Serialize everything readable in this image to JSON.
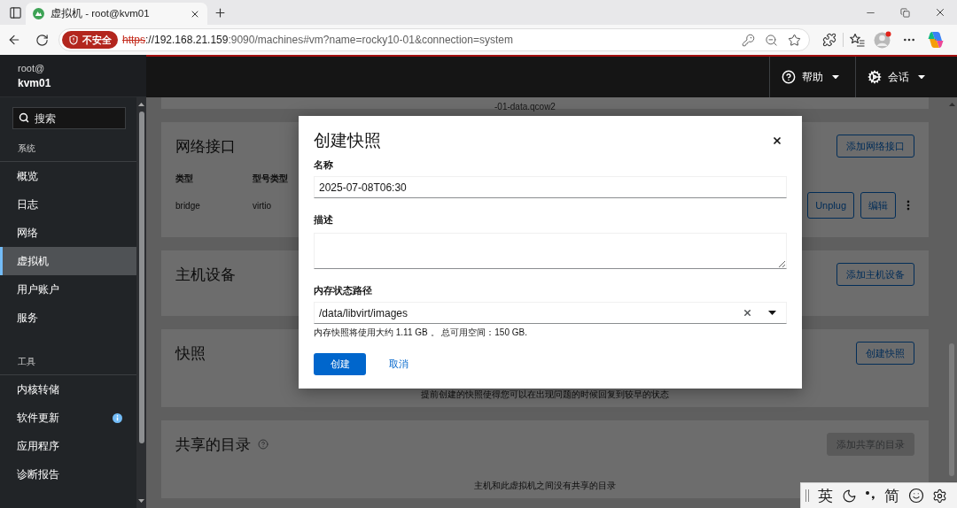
{
  "browser": {
    "tab": {
      "title": "虚拟机 - root@kvm01",
      "selected": true
    },
    "security_label": "不安全",
    "url": {
      "scheme": "https",
      "host": "://192.168.21.159",
      "path": ":9090/machines#vm?name=rocky10-01&connection=system"
    }
  },
  "sidebar": {
    "user": "root@",
    "host": "kvm01",
    "search": {
      "placeholder": "搜索"
    },
    "sections": [
      {
        "title": "系统",
        "items": [
          {
            "label": "概览",
            "selected": false,
            "notification": false
          },
          {
            "label": "日志",
            "selected": false,
            "notification": false
          },
          {
            "label": "网络",
            "selected": false,
            "notification": false
          },
          {
            "label": "虚拟机",
            "selected": true,
            "notification": false
          },
          {
            "label": "用户账户",
            "selected": false,
            "notification": false
          },
          {
            "label": "服务",
            "selected": false,
            "notification": false
          }
        ]
      },
      {
        "title": "工具",
        "items": [
          {
            "label": "内核转储",
            "selected": false,
            "notification": false
          },
          {
            "label": "软件更新",
            "selected": false,
            "notification": true
          },
          {
            "label": "应用程序",
            "selected": false,
            "notification": false
          },
          {
            "label": "诊断报告",
            "selected": false,
            "notification": false
          }
        ]
      }
    ]
  },
  "header": {
    "menus": [
      {
        "kind": "help",
        "label": "帮助"
      },
      {
        "kind": "session",
        "label": "会话"
      }
    ]
  },
  "content": {
    "disk_fragment": "-01-data.qcow2",
    "cards": [
      {
        "title": "网络接口",
        "help": false,
        "button": {
          "label": "添加网络接口",
          "disabled": false
        },
        "table": {
          "columns": [
            "类型",
            "型号类型"
          ],
          "rows": [
            {
              "cells": [
                "bridge",
                "virtio"
              ],
              "actions": [
                "Unplug",
                "编辑"
              ]
            }
          ]
        }
      },
      {
        "title": "主机设备",
        "help": false,
        "button": {
          "label": "添加主机设备",
          "disabled": false
        }
      },
      {
        "title": "快照",
        "help": false,
        "button": {
          "label": "创建快照",
          "disabled": false
        },
        "empty_text": "提前创建的快照使得您可以在出现问题的时候回复到较早的状态"
      },
      {
        "title": "共享的目录",
        "help": true,
        "button": {
          "label": "添加共享的目录",
          "disabled": true
        },
        "empty_text": "主机和此虚拟机之间没有共享的目录"
      }
    ]
  },
  "dialog": {
    "title": "创建快照",
    "fields": [
      {
        "kind": "text",
        "label": "名称",
        "value": "2025-07-08T06:30"
      },
      {
        "kind": "textarea",
        "label": "描述"
      },
      {
        "kind": "select",
        "label": "内存状态路径",
        "value": "/data/libvirt/images",
        "helper": "内存快照将使用大约 1.11 GB 。 总可用空间：150 GB."
      }
    ],
    "buttons": [
      {
        "kind": "primary",
        "label": "创建"
      },
      {
        "kind": "link",
        "label": "取消"
      }
    ]
  },
  "ime_bar": {
    "items": [
      {
        "kind": "text",
        "label": "英"
      },
      {
        "kind": "moon"
      },
      {
        "kind": "punctuation"
      },
      {
        "kind": "text",
        "label": "简"
      },
      {
        "kind": "emoji"
      },
      {
        "kind": "settings"
      }
    ]
  }
}
